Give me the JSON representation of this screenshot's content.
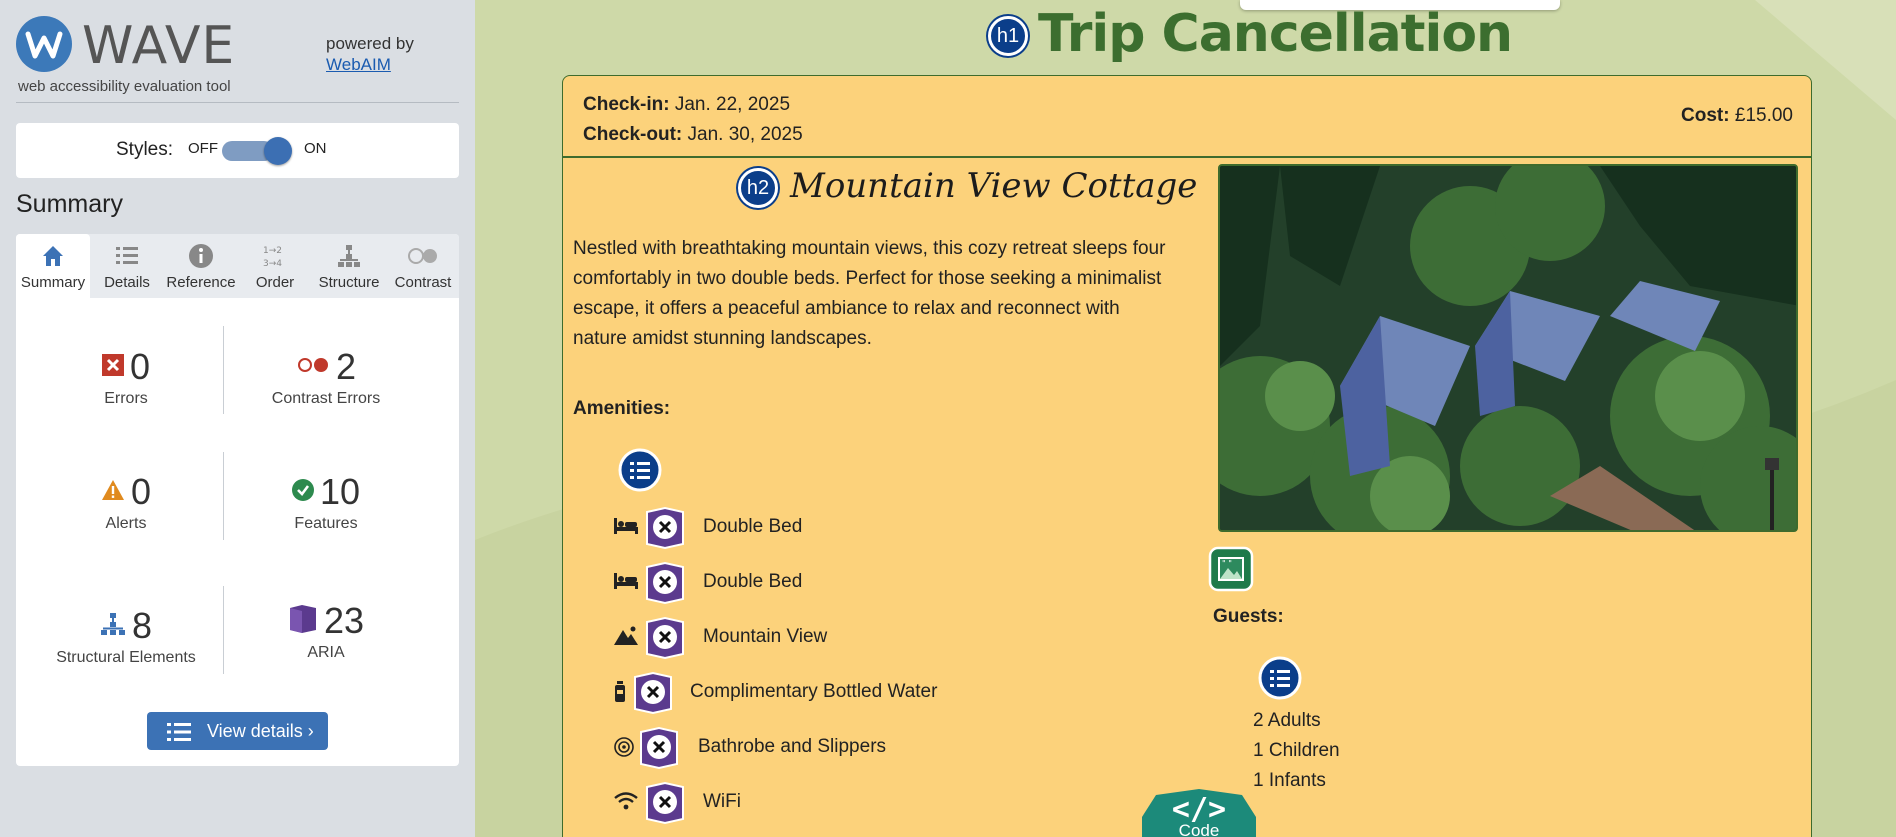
{
  "wave": {
    "logo_text": "WAVE",
    "tagline": "web accessibility evaluation tool",
    "powered_by": "powered by",
    "powered_link": "WebAIM",
    "styles_label": "Styles:",
    "styles_off": "OFF",
    "styles_on": "ON",
    "summary_heading": "Summary",
    "tabs": [
      {
        "label": "Summary",
        "icon": "home-icon"
      },
      {
        "label": "Details",
        "icon": "list-icon"
      },
      {
        "label": "Reference",
        "icon": "info-icon"
      },
      {
        "label": "Order",
        "icon": "order-icon"
      },
      {
        "label": "Structure",
        "icon": "structure-icon"
      },
      {
        "label": "Contrast",
        "icon": "contrast-icon"
      }
    ],
    "stats": {
      "errors": {
        "value": "0",
        "label": "Errors"
      },
      "contrast_errors": {
        "value": "2",
        "label": "Contrast Errors"
      },
      "alerts": {
        "value": "0",
        "label": "Alerts"
      },
      "features": {
        "value": "10",
        "label": "Features"
      },
      "structural": {
        "value": "8",
        "label": "Structural Elements"
      },
      "aria": {
        "value": "23",
        "label": "ARIA"
      }
    },
    "view_details": "View details ›",
    "colors": {
      "accent": "#3c72b5",
      "error": "#c0392b",
      "alert": "#e08a1e",
      "feature": "#2d8a4e",
      "aria": "#5b3a8e"
    }
  },
  "page": {
    "h1_badge": "h1",
    "title": "Trip Cancellation",
    "checkin_label": "Check-in:",
    "checkin_value": "Jan. 22, 2025",
    "checkout_label": "Check-out:",
    "checkout_value": "Jan. 30, 2025",
    "cost_label": "Cost:",
    "cost_value": "£15.00",
    "h2_badge": "h2",
    "cottage_name": "Mountain View Cottage",
    "description": "Nestled with breathtaking mountain views, this cozy retreat sleeps four comfortably in two double beds. Perfect for those seeking a minimalist escape, it offers a peaceful ambiance to relax and reconnect with nature amidst stunning landscapes.",
    "amenities_label": "Amenities:",
    "amenities": [
      {
        "text": "Double Bed",
        "icon": "bed-icon"
      },
      {
        "text": "Double Bed",
        "icon": "bed-icon"
      },
      {
        "text": "Mountain View",
        "icon": "mountain-icon"
      },
      {
        "text": "Complimentary Bottled Water",
        "icon": "bottle-icon"
      },
      {
        "text": "Bathrobe and Slippers",
        "icon": "bathrobe-icon"
      },
      {
        "text": "WiFi",
        "icon": "wifi-icon"
      }
    ],
    "guests_label": "Guests:",
    "guests": [
      "2 Adults",
      "1 Children",
      "1 Infants"
    ],
    "code_label": "Code",
    "colors": {
      "background": "#ced9a8",
      "card": "#fcd27b",
      "title": "#3c6e2f"
    }
  }
}
